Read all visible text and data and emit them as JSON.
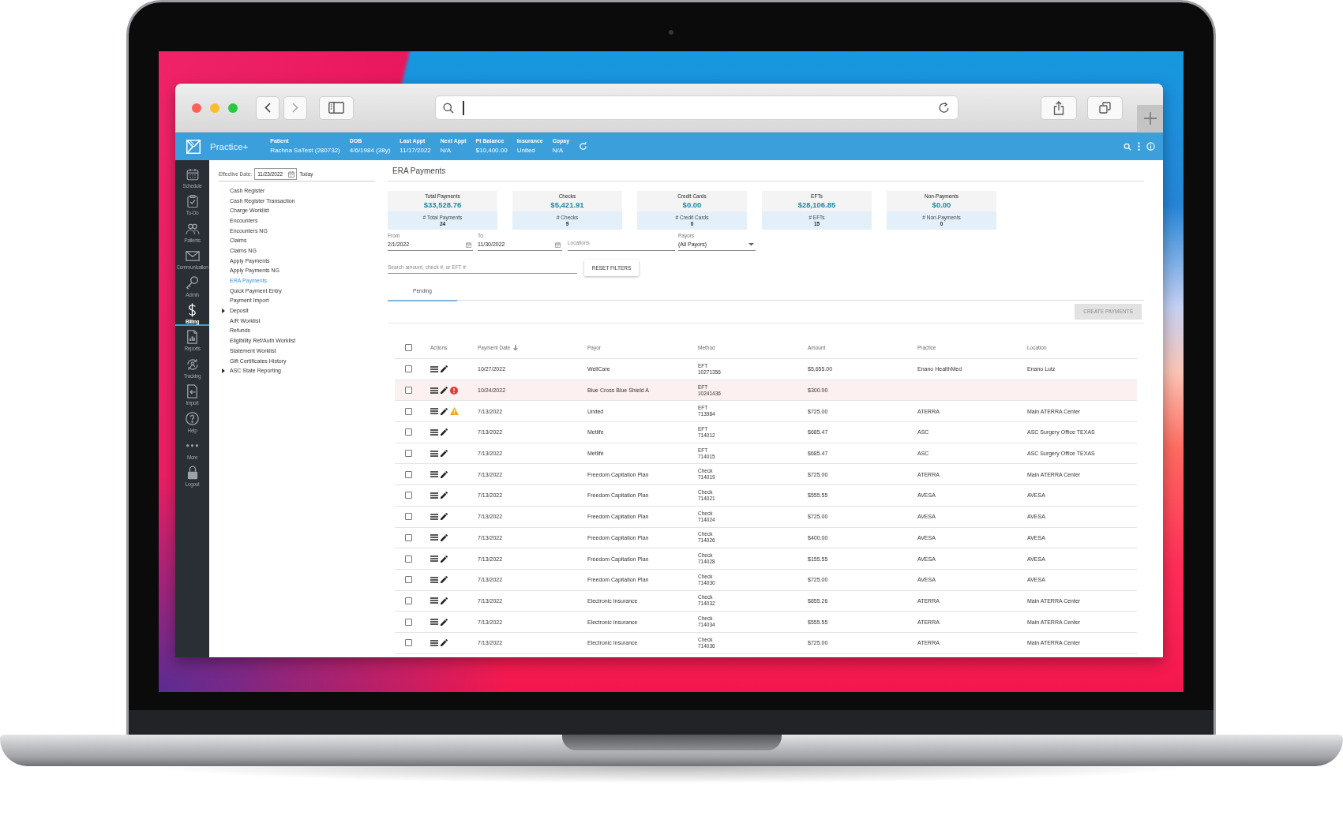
{
  "header": {
    "brand": "Practice+",
    "patient_bar": [
      {
        "label": "Patient",
        "value": "Rachna SaTest (280732)"
      },
      {
        "label": "DOB",
        "value": "4/6/1984 (38y)"
      },
      {
        "label": "Last Appt",
        "value": "11/17/2022"
      },
      {
        "label": "Next Appt",
        "value": "N/A"
      },
      {
        "label": "Pt Balance",
        "value": "$10,400.00"
      },
      {
        "label": "Insurance",
        "value": "United"
      },
      {
        "label": "Copay",
        "value": "N/A"
      }
    ]
  },
  "sidebar": {
    "nav": [
      {
        "label": "Schedule",
        "selected": false
      },
      {
        "label": "To-Do",
        "selected": false
      },
      {
        "label": "Patients",
        "selected": false
      },
      {
        "label": "Communication",
        "selected": false
      },
      {
        "label": "Admin",
        "selected": false
      },
      {
        "label": "Billing",
        "selected": true
      },
      {
        "label": "Reports",
        "selected": false
      },
      {
        "label": "Tracking",
        "selected": false
      },
      {
        "label": "Import",
        "selected": false
      },
      {
        "label": "Help",
        "selected": false
      },
      {
        "label": "More",
        "selected": false
      },
      {
        "label": "Logout",
        "selected": false
      }
    ]
  },
  "menu": {
    "effective_date": {
      "label": "Effective Date:",
      "value": "11/23/2022",
      "today_link": "Today"
    },
    "items": [
      {
        "kind": "link",
        "label": "Cash Register",
        "selected": false
      },
      {
        "kind": "link",
        "label": "Cash Register Transaction",
        "selected": false
      },
      {
        "kind": "link",
        "label": "Charge Worklist",
        "selected": false
      },
      {
        "kind": "link",
        "label": "Encounters",
        "selected": false
      },
      {
        "kind": "link",
        "label": "Encounters NG",
        "selected": false
      },
      {
        "kind": "link",
        "label": "Claims",
        "selected": false
      },
      {
        "kind": "link",
        "label": "Claims NG",
        "selected": false
      },
      {
        "kind": "link",
        "label": "Apply Payments",
        "selected": false
      },
      {
        "kind": "link",
        "label": "Apply Payments NG",
        "selected": false
      },
      {
        "kind": "link",
        "label": "ERA Payments",
        "selected": true
      },
      {
        "kind": "link",
        "label": "Quick Payment Entry",
        "selected": false
      },
      {
        "kind": "link",
        "label": "Payment Import",
        "selected": false
      },
      {
        "kind": "group",
        "label": "Deposit",
        "selected": false,
        "expanded": false
      },
      {
        "kind": "link",
        "label": "A/R Worklist",
        "selected": false
      },
      {
        "kind": "link",
        "label": "Refunds",
        "selected": false
      },
      {
        "kind": "link",
        "label": "Eligibility Ref/Auth Worklist",
        "selected": false
      },
      {
        "kind": "link",
        "label": "Statement Worklist",
        "selected": false
      },
      {
        "kind": "link",
        "label": "Gift Certificates History",
        "selected": false
      },
      {
        "kind": "group",
        "label": "ASC State Reporting",
        "selected": false,
        "expanded": false
      }
    ]
  },
  "page": {
    "title": "ERA Payments",
    "summary_cards": [
      {
        "title": "Total Payments",
        "amount": "$33,528.76",
        "count_label": "# Total Payments",
        "count": "24"
      },
      {
        "title": "Checks",
        "amount": "$5,421.91",
        "count_label": "# Checks",
        "count": "9"
      },
      {
        "title": "Credit Cards",
        "amount": "$0.00",
        "count_label": "# Credit Cards",
        "count": "0"
      },
      {
        "title": "EFTs",
        "amount": "$28,106.85",
        "count_label": "# EFTs",
        "count": "15"
      },
      {
        "title": "Non-Payments",
        "amount": "$0.00",
        "count_label": "# Non-Payments",
        "count": "0"
      }
    ],
    "filters": {
      "from": {
        "label": "From",
        "value": "2/1/2022"
      },
      "to": {
        "label": "To",
        "value": "11/30/2022"
      },
      "locations": {
        "placeholder": "Locations"
      },
      "payors": {
        "label": "Payors",
        "value": "(All Payors)"
      }
    },
    "search": {
      "placeholder": "Search amount, check #, or EFT #"
    },
    "reset_button": "RESET FILTERS",
    "tabs": [
      {
        "label": "Pending",
        "selected": true
      }
    ],
    "create_button": {
      "label": "CREATE PAYMENTS",
      "disabled": true
    },
    "table": {
      "select_all_checked": false,
      "columns": [
        {
          "label": "Actions",
          "sorted": false
        },
        {
          "label": "Payment Date",
          "sorted": true
        },
        {
          "label": "Payor",
          "sorted": false
        },
        {
          "label": "Method",
          "sorted": false
        },
        {
          "label": "Amount",
          "sorted": false
        },
        {
          "label": "Practice",
          "sorted": false
        },
        {
          "label": "Location",
          "sorted": false
        }
      ],
      "rows": [
        {
          "checked": false,
          "error": false,
          "warning": false,
          "payment_date": "10/27/2022",
          "payor": "WellCare",
          "method": "EFT",
          "method_number": "10271356",
          "amount": "$5,655.00",
          "practice": "Enano HealthMed",
          "location": "Enano Lutz"
        },
        {
          "checked": false,
          "error": true,
          "warning": false,
          "payment_date": "10/24/2022",
          "payor": "Blue Cross Blue Shield A",
          "method": "EFT",
          "method_number": "10241436",
          "amount": "$300.00"
        },
        {
          "checked": false,
          "error": false,
          "warning": true,
          "payment_date": "7/13/2022",
          "payor": "United",
          "method": "EFT",
          "method_number": "713984",
          "amount": "$725.00",
          "practice": "ATERRA",
          "location": "Main ATERRA Center"
        },
        {
          "checked": false,
          "error": false,
          "warning": false,
          "payment_date": "7/13/2022",
          "payor": "Metlife",
          "method": "EFT",
          "method_number": "714012",
          "amount": "$685.47",
          "practice": "ASC",
          "location": "ASC Surgery Office TEXAS"
        },
        {
          "checked": false,
          "error": false,
          "warning": false,
          "payment_date": "7/13/2022",
          "payor": "Metlife",
          "method": "EFT",
          "method_number": "714015",
          "amount": "$685.47",
          "practice": "ASC",
          "location": "ASC Surgery Office TEXAS"
        },
        {
          "checked": false,
          "error": false,
          "warning": false,
          "payment_date": "7/13/2022",
          "payor": "Freedom Capitation Plan",
          "method": "Check",
          "method_number": "714019",
          "amount": "$725.00",
          "practice": "ATERRA",
          "location": "Main ATERRA Center"
        },
        {
          "checked": false,
          "error": false,
          "warning": false,
          "payment_date": "7/13/2022",
          "payor": "Freedom Capitation Plan",
          "method": "Check",
          "method_number": "714021",
          "amount": "$555.55",
          "practice": "AVESA",
          "location": "AVESA"
        },
        {
          "checked": false,
          "error": false,
          "warning": false,
          "payment_date": "7/13/2022",
          "payor": "Freedom Capitation Plan",
          "method": "Check",
          "method_number": "714024",
          "amount": "$725.00",
          "practice": "AVESA",
          "location": "AVESA"
        },
        {
          "checked": false,
          "error": false,
          "warning": false,
          "payment_date": "7/13/2022",
          "payor": "Freedom Capitation Plan",
          "method": "Check",
          "method_number": "714026",
          "amount": "$400.00",
          "practice": "AVESA",
          "location": "AVESA"
        },
        {
          "checked": false,
          "error": false,
          "warning": false,
          "payment_date": "7/13/2022",
          "payor": "Freedom Capitation Plan",
          "method": "Check",
          "method_number": "714028",
          "amount": "$155.55",
          "practice": "AVESA",
          "location": "AVESA"
        },
        {
          "checked": false,
          "error": false,
          "warning": false,
          "payment_date": "7/13/2022",
          "payor": "Freedom Capitation Plan",
          "method": "Check",
          "method_number": "714030",
          "amount": "$725.00",
          "practice": "AVESA",
          "location": "AVESA"
        },
        {
          "checked": false,
          "error": false,
          "warning": false,
          "payment_date": "7/13/2022",
          "payor": "Electronic Insurance",
          "method": "Check",
          "method_number": "714032",
          "amount": "$855.26",
          "practice": "ATERRA",
          "location": "Main ATERRA Center"
        },
        {
          "checked": false,
          "error": false,
          "warning": false,
          "payment_date": "7/13/2022",
          "payor": "Electronic Insurance",
          "method": "Check",
          "method_number": "714034",
          "amount": "$555.55",
          "practice": "ATERRA",
          "location": "Main ATERRA Center"
        },
        {
          "checked": false,
          "error": false,
          "warning": false,
          "payment_date": "7/13/2022",
          "payor": "Electronic Insurance",
          "method": "Check",
          "method_number": "714036",
          "amount": "$725.00",
          "practice": "ATERRA",
          "location": "Main ATERRA Center"
        }
      ]
    }
  }
}
